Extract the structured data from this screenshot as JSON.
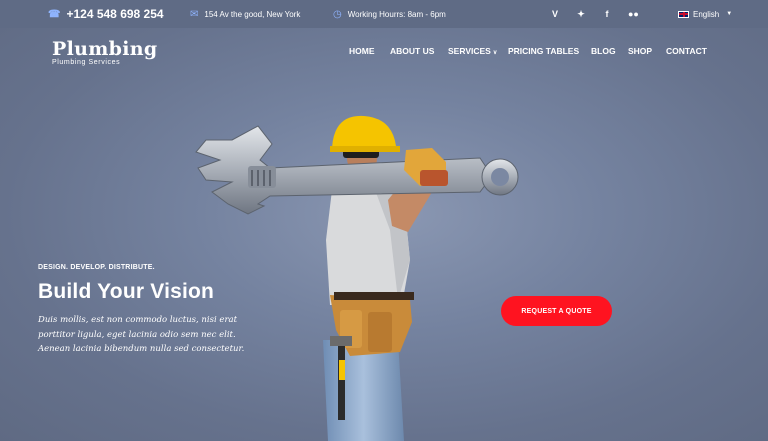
{
  "topbar": {
    "phone": "+124 548 698 254",
    "address": "154 Av the good, New York",
    "hours": "Working Hourrs: 8am - 6pm",
    "social_icons": [
      "vine-icon",
      "twitter-icon",
      "facebook-icon",
      "flickr-icon"
    ],
    "language": "English"
  },
  "logo": {
    "name": "Plumbing",
    "subtitle": "Plumbing Services"
  },
  "nav": {
    "items": [
      "HOME",
      "ABOUT US",
      "SERVICES",
      "PRICING TABLES",
      "BLOG",
      "SHOP",
      "CONTACT"
    ]
  },
  "hero": {
    "tagline": "DESIGN. DEVELOP. DISTRIBUTE.",
    "headline": "Build Your Vision",
    "body": "Duis mollis, est non commodo luctus, nisi erat porttitor ligula, eget lacinia odio sem nec elit. Aenean lacinia bibendum nulla sed consectetur.",
    "cta_label": "REQUEST A QUOTE"
  },
  "colors": {
    "topbar_bg": "#5f6b85",
    "hero_bg": "#6b7790",
    "cta": "#ff1320",
    "icon_accent": "#8fb4ff",
    "helmet": "#f5c400"
  }
}
